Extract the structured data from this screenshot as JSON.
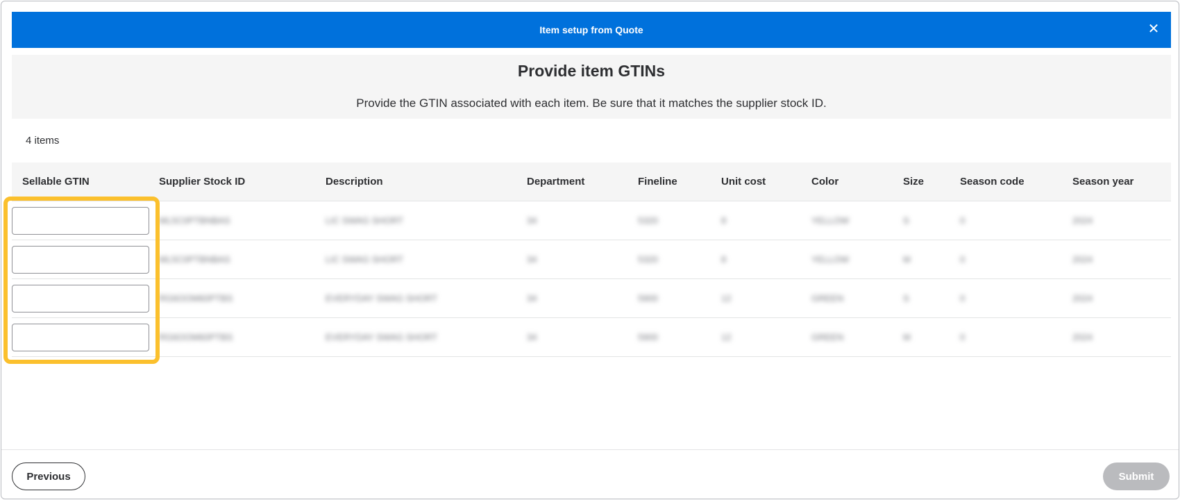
{
  "modal": {
    "title": "Item setup from Quote",
    "close_icon": "close-icon"
  },
  "intro": {
    "heading": "Provide item GTINs",
    "text": "Provide the GTIN associated with each item. Be sure that it matches the supplier stock ID."
  },
  "item_count": "4 items",
  "table": {
    "columns": [
      "Sellable GTIN",
      "Supplier Stock ID",
      "Description",
      "Department",
      "Fineline",
      "Unit cost",
      "Color",
      "Size",
      "Season code",
      "Season year"
    ],
    "rows": [
      {
        "gtin": "",
        "supplier_stock_id": "ML5C0PTBNBAS",
        "description": "LIC SWAG SHORT",
        "department": "34",
        "fineline": "5320",
        "unit_cost": "8",
        "color": "YELLOW",
        "size": "S",
        "season_code": "0",
        "season_year": "2024"
      },
      {
        "gtin": "",
        "supplier_stock_id": "ML5C0PTBNBAS",
        "description": "LIC SWAG SHORT",
        "department": "34",
        "fineline": "5320",
        "unit_cost": "8",
        "color": "YELLOW",
        "size": "M",
        "season_code": "0",
        "season_year": "2024"
      },
      {
        "gtin": "",
        "supplier_stock_id": "RG6OOM60PTBS",
        "description": "EVERYDAY SWAG SHORT",
        "department": "34",
        "fineline": "5900",
        "unit_cost": "12",
        "color": "GREEN",
        "size": "S",
        "season_code": "0",
        "season_year": "2024"
      },
      {
        "gtin": "",
        "supplier_stock_id": "RG6OOM60PTBS",
        "description": "EVERYDAY SWAG SHORT",
        "department": "34",
        "fineline": "5900",
        "unit_cost": "12",
        "color": "GREEN",
        "size": "M",
        "season_code": "0",
        "season_year": "2024"
      }
    ]
  },
  "footer": {
    "previous_label": "Previous",
    "submit_label": "Submit"
  },
  "colors": {
    "header": "#0071dc",
    "highlight": "#fbc02d",
    "submit_disabled": "#babbbe"
  }
}
